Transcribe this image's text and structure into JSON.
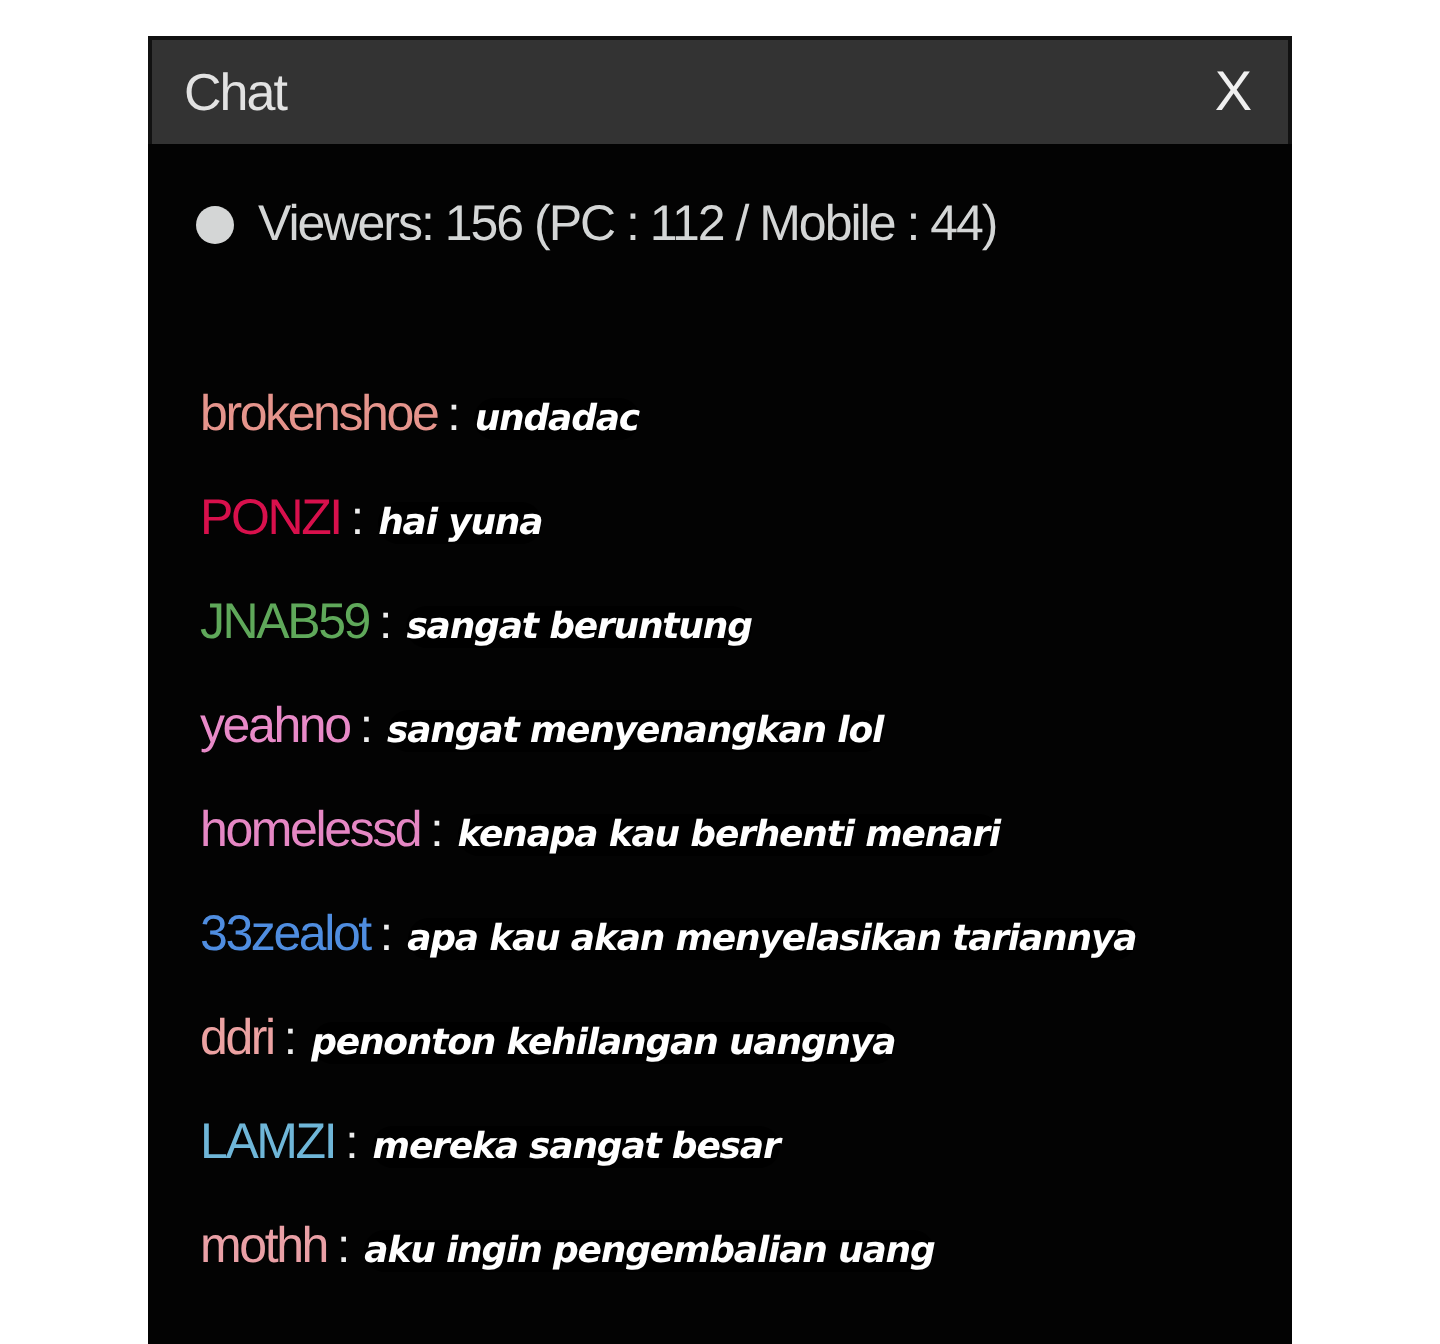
{
  "window": {
    "title": "Chat",
    "close": "X"
  },
  "viewers": {
    "text": "Viewers: 156 (PC : 112 / Mobile : 44)",
    "color": "#d4d6d6"
  },
  "messages": [
    {
      "user": "brokenshoe",
      "color": "#e5948c",
      "separator": ":",
      "text": "undadac"
    },
    {
      "user": "PONZI",
      "color": "#d8104c",
      "separator": ":",
      "text": "hai yuna"
    },
    {
      "user": "JNAB59",
      "color": "#5fa85a",
      "separator": ":",
      "text": "sangat beruntung"
    },
    {
      "user": "yeahno",
      "color": "#e88ac8",
      "separator": ":",
      "text": "sangat menyenangkan lol"
    },
    {
      "user": "homelessd",
      "color": "#e587c4",
      "separator": ":",
      "text": "kenapa kau berhenti menari"
    },
    {
      "user": "33zealot",
      "color": "#4f8de0",
      "separator": ":",
      "text": "apa kau akan menyelasikan tariannya"
    },
    {
      "user": "ddri",
      "color": "#eca2a2",
      "separator": ":",
      "text": "penonton kehilangan uangnya"
    },
    {
      "user": "LAMZI",
      "color": "#6fb6d8",
      "separator": ":",
      "text": "mereka sangat besar"
    },
    {
      "user": "mothh",
      "color": "#eaa0a6",
      "separator": ":",
      "text": "aku ingin pengembalian uang"
    }
  ]
}
